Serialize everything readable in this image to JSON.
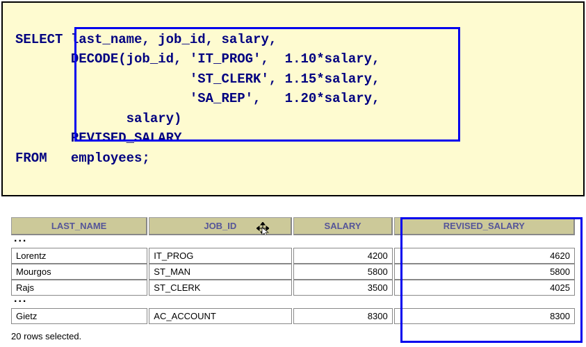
{
  "sql": {
    "line1": "SELECT last_name, job_id, salary,",
    "line2": "       DECODE(job_id, 'IT_PROG',  1.10*salary,",
    "line3": "                      'ST_CLERK', 1.15*salary,",
    "line4": "                      'SA_REP',   1.20*salary,",
    "line5": "              salary)",
    "line6": "       REVISED_SALARY",
    "line7": "FROM   employees;"
  },
  "table": {
    "headers": {
      "last_name": "LAST_NAME",
      "job_id": "JOB_ID",
      "salary": "SALARY",
      "revised_salary": "REVISED_SALARY"
    },
    "ellipsis": "...",
    "rows": [
      {
        "last_name": "Lorentz",
        "job_id": "IT_PROG",
        "salary": "4200",
        "revised_salary": "4620"
      },
      {
        "last_name": "Mourgos",
        "job_id": "ST_MAN",
        "salary": "5800",
        "revised_salary": "5800"
      },
      {
        "last_name": "Rajs",
        "job_id": "ST_CLERK",
        "salary": "3500",
        "revised_salary": "4025"
      }
    ],
    "last_row": {
      "last_name": "Gietz",
      "job_id": "AC_ACCOUNT",
      "salary": "8300",
      "revised_salary": "8300"
    }
  },
  "footer": "20 rows selected."
}
